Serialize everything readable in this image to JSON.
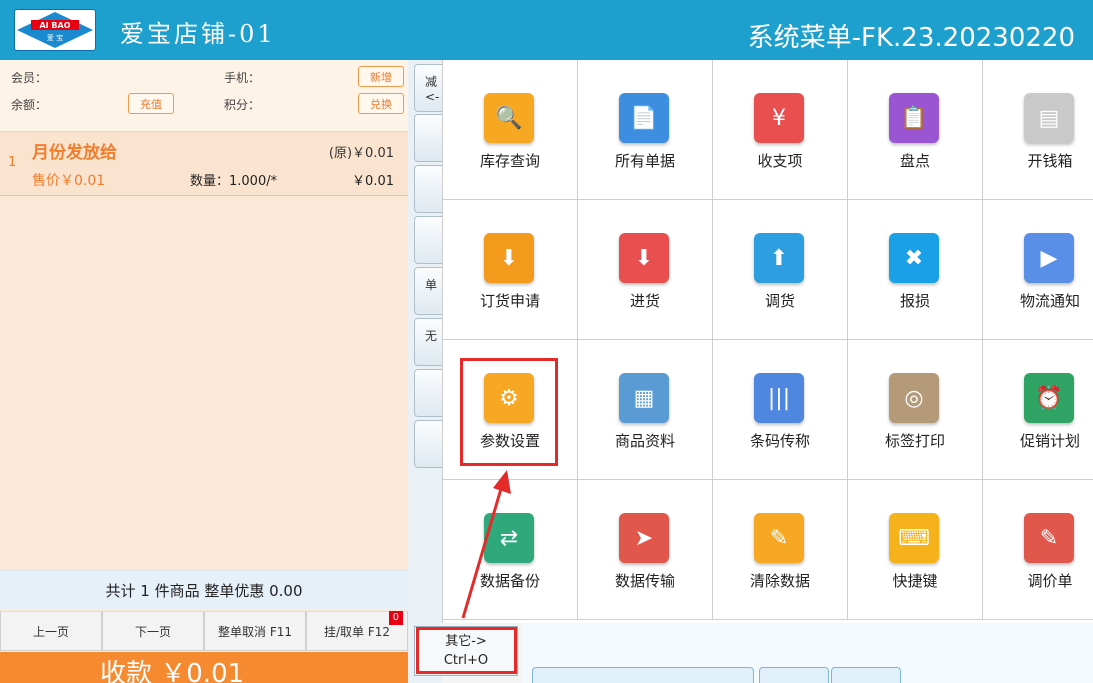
{
  "header": {
    "logo_text_top": "AI BAO",
    "logo_text_bottom": "爱 宝",
    "store_name": "爱宝店铺-01",
    "system_title": "系统菜单-FK.23.20230220"
  },
  "member": {
    "member_label": "会员：",
    "phone_label": "手机：",
    "new_button": "新增",
    "balance_label": "余额：",
    "recharge_button": "充值",
    "points_label": "积分：",
    "exchange_button": "兑换"
  },
  "item": {
    "index": "1",
    "name": "月份发放给",
    "original_price": "(原)￥0.01",
    "sale_price": "售价￥0.01",
    "quantity": "数量：1.000/*",
    "total": "￥0.01"
  },
  "summary": "共计 1 件商品 整单优惠 0.00",
  "bottom_buttons": [
    "上一页",
    "下一页",
    "整单取消 F11",
    "挂/取单 F12"
  ],
  "hold_count": "0",
  "pay_label": "收款 ￥0.01",
  "mid_buttons": [
    "减",
    "<-",
    "",
    "",
    "单",
    "无",
    "",
    ""
  ],
  "menu": [
    {
      "label": "库存查询",
      "icon": "inventory-query-icon",
      "color": "#f7a823"
    },
    {
      "label": "所有单据",
      "icon": "documents-icon",
      "color": "#3d8de0"
    },
    {
      "label": "收支项",
      "icon": "income-expense-icon",
      "color": "#e94f4f"
    },
    {
      "label": "盘点",
      "icon": "stocktake-icon",
      "color": "#9a55d3"
    },
    {
      "label": "开钱箱",
      "icon": "cash-drawer-icon",
      "color": "#c9c9c9"
    },
    {
      "label": "订货申请",
      "icon": "order-request-icon",
      "color": "#f39a1c"
    },
    {
      "label": "进货",
      "icon": "purchase-icon",
      "color": "#e94f4f"
    },
    {
      "label": "调货",
      "icon": "transfer-icon",
      "color": "#2d9ee0"
    },
    {
      "label": "报损",
      "icon": "damage-report-icon",
      "color": "#1aa0e6"
    },
    {
      "label": "物流通知",
      "icon": "logistics-icon",
      "color": "#5a8fe8"
    },
    {
      "label": "参数设置",
      "icon": "settings-gears-icon",
      "color": "#f6a724"
    },
    {
      "label": "商品资料",
      "icon": "product-info-icon",
      "color": "#5b9bd5"
    },
    {
      "label": "条码传称",
      "icon": "barcode-scale-icon",
      "color": "#4f86e0"
    },
    {
      "label": "标签打印",
      "icon": "label-print-icon",
      "color": "#b59a7a"
    },
    {
      "label": "促销计划",
      "icon": "promotion-clock-icon",
      "color": "#2fa363"
    },
    {
      "label": "数据备份",
      "icon": "data-backup-icon",
      "color": "#2fa87c"
    },
    {
      "label": "数据传输",
      "icon": "data-transfer-icon",
      "color": "#e2574c"
    },
    {
      "label": "清除数据",
      "icon": "broom-icon",
      "color": "#f6a724"
    },
    {
      "label": "快捷键",
      "icon": "keyboard-icon",
      "color": "#f6b21b"
    },
    {
      "label": "调价单",
      "icon": "price-adjust-icon",
      "color": "#e2574c"
    }
  ],
  "other_button": {
    "line1": "其它->",
    "line2": "Ctrl+O"
  }
}
